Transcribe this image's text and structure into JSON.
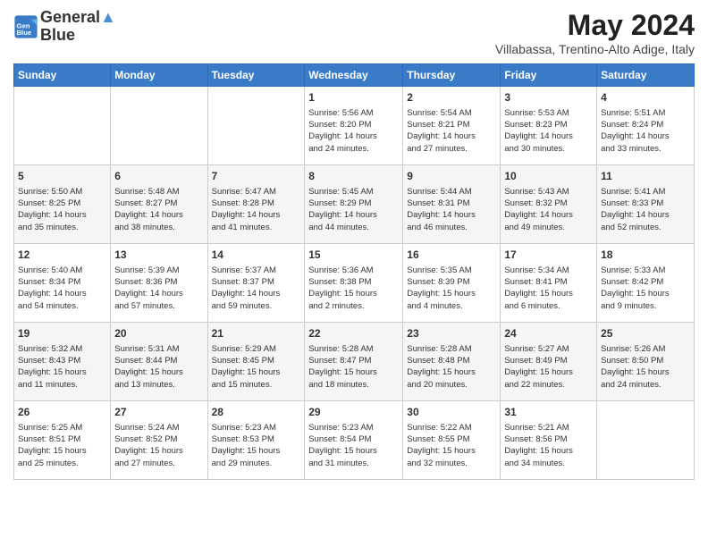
{
  "logo": {
    "line1": "General",
    "line2": "Blue"
  },
  "header": {
    "title": "May 2024",
    "subtitle": "Villabassa, Trentino-Alto Adige, Italy"
  },
  "weekdays": [
    "Sunday",
    "Monday",
    "Tuesday",
    "Wednesday",
    "Thursday",
    "Friday",
    "Saturday"
  ],
  "weeks": [
    [
      {
        "day": "",
        "info": ""
      },
      {
        "day": "",
        "info": ""
      },
      {
        "day": "",
        "info": ""
      },
      {
        "day": "1",
        "info": "Sunrise: 5:56 AM\nSunset: 8:20 PM\nDaylight: 14 hours\nand 24 minutes."
      },
      {
        "day": "2",
        "info": "Sunrise: 5:54 AM\nSunset: 8:21 PM\nDaylight: 14 hours\nand 27 minutes."
      },
      {
        "day": "3",
        "info": "Sunrise: 5:53 AM\nSunset: 8:23 PM\nDaylight: 14 hours\nand 30 minutes."
      },
      {
        "day": "4",
        "info": "Sunrise: 5:51 AM\nSunset: 8:24 PM\nDaylight: 14 hours\nand 33 minutes."
      }
    ],
    [
      {
        "day": "5",
        "info": "Sunrise: 5:50 AM\nSunset: 8:25 PM\nDaylight: 14 hours\nand 35 minutes."
      },
      {
        "day": "6",
        "info": "Sunrise: 5:48 AM\nSunset: 8:27 PM\nDaylight: 14 hours\nand 38 minutes."
      },
      {
        "day": "7",
        "info": "Sunrise: 5:47 AM\nSunset: 8:28 PM\nDaylight: 14 hours\nand 41 minutes."
      },
      {
        "day": "8",
        "info": "Sunrise: 5:45 AM\nSunset: 8:29 PM\nDaylight: 14 hours\nand 44 minutes."
      },
      {
        "day": "9",
        "info": "Sunrise: 5:44 AM\nSunset: 8:31 PM\nDaylight: 14 hours\nand 46 minutes."
      },
      {
        "day": "10",
        "info": "Sunrise: 5:43 AM\nSunset: 8:32 PM\nDaylight: 14 hours\nand 49 minutes."
      },
      {
        "day": "11",
        "info": "Sunrise: 5:41 AM\nSunset: 8:33 PM\nDaylight: 14 hours\nand 52 minutes."
      }
    ],
    [
      {
        "day": "12",
        "info": "Sunrise: 5:40 AM\nSunset: 8:34 PM\nDaylight: 14 hours\nand 54 minutes."
      },
      {
        "day": "13",
        "info": "Sunrise: 5:39 AM\nSunset: 8:36 PM\nDaylight: 14 hours\nand 57 minutes."
      },
      {
        "day": "14",
        "info": "Sunrise: 5:37 AM\nSunset: 8:37 PM\nDaylight: 14 hours\nand 59 minutes."
      },
      {
        "day": "15",
        "info": "Sunrise: 5:36 AM\nSunset: 8:38 PM\nDaylight: 15 hours\nand 2 minutes."
      },
      {
        "day": "16",
        "info": "Sunrise: 5:35 AM\nSunset: 8:39 PM\nDaylight: 15 hours\nand 4 minutes."
      },
      {
        "day": "17",
        "info": "Sunrise: 5:34 AM\nSunset: 8:41 PM\nDaylight: 15 hours\nand 6 minutes."
      },
      {
        "day": "18",
        "info": "Sunrise: 5:33 AM\nSunset: 8:42 PM\nDaylight: 15 hours\nand 9 minutes."
      }
    ],
    [
      {
        "day": "19",
        "info": "Sunrise: 5:32 AM\nSunset: 8:43 PM\nDaylight: 15 hours\nand 11 minutes."
      },
      {
        "day": "20",
        "info": "Sunrise: 5:31 AM\nSunset: 8:44 PM\nDaylight: 15 hours\nand 13 minutes."
      },
      {
        "day": "21",
        "info": "Sunrise: 5:29 AM\nSunset: 8:45 PM\nDaylight: 15 hours\nand 15 minutes."
      },
      {
        "day": "22",
        "info": "Sunrise: 5:28 AM\nSunset: 8:47 PM\nDaylight: 15 hours\nand 18 minutes."
      },
      {
        "day": "23",
        "info": "Sunrise: 5:28 AM\nSunset: 8:48 PM\nDaylight: 15 hours\nand 20 minutes."
      },
      {
        "day": "24",
        "info": "Sunrise: 5:27 AM\nSunset: 8:49 PM\nDaylight: 15 hours\nand 22 minutes."
      },
      {
        "day": "25",
        "info": "Sunrise: 5:26 AM\nSunset: 8:50 PM\nDaylight: 15 hours\nand 24 minutes."
      }
    ],
    [
      {
        "day": "26",
        "info": "Sunrise: 5:25 AM\nSunset: 8:51 PM\nDaylight: 15 hours\nand 25 minutes."
      },
      {
        "day": "27",
        "info": "Sunrise: 5:24 AM\nSunset: 8:52 PM\nDaylight: 15 hours\nand 27 minutes."
      },
      {
        "day": "28",
        "info": "Sunrise: 5:23 AM\nSunset: 8:53 PM\nDaylight: 15 hours\nand 29 minutes."
      },
      {
        "day": "29",
        "info": "Sunrise: 5:23 AM\nSunset: 8:54 PM\nDaylight: 15 hours\nand 31 minutes."
      },
      {
        "day": "30",
        "info": "Sunrise: 5:22 AM\nSunset: 8:55 PM\nDaylight: 15 hours\nand 32 minutes."
      },
      {
        "day": "31",
        "info": "Sunrise: 5:21 AM\nSunset: 8:56 PM\nDaylight: 15 hours\nand 34 minutes."
      },
      {
        "day": "",
        "info": ""
      }
    ]
  ]
}
